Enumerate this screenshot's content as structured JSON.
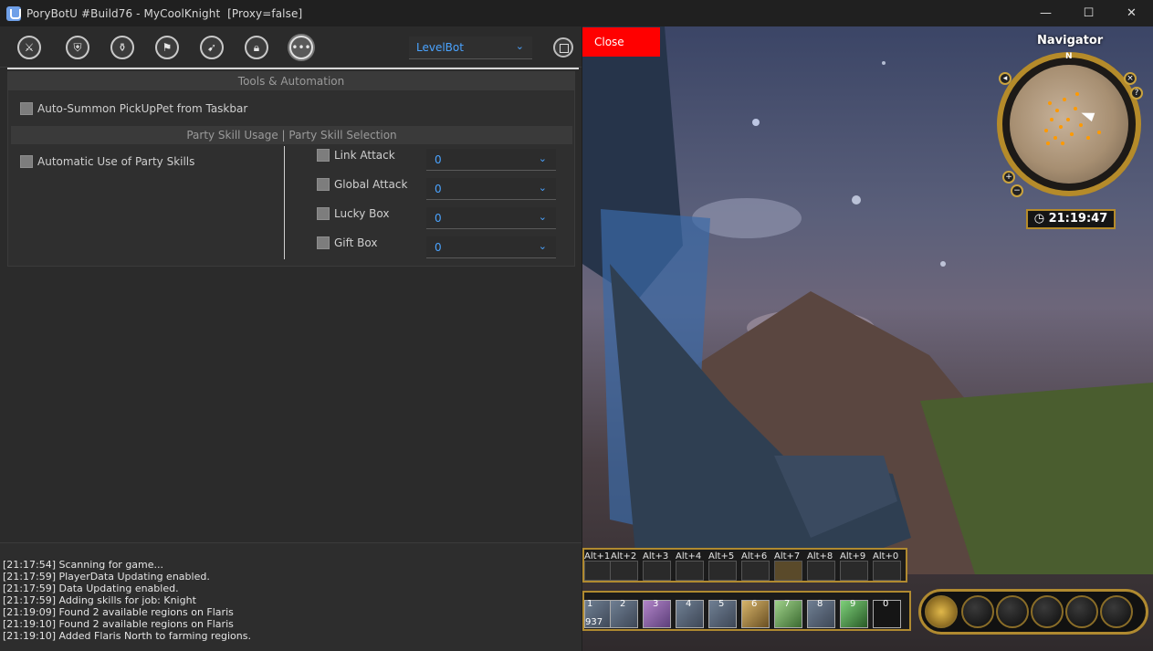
{
  "window": {
    "title": "PoryBotU #Build76 - MyCoolKnight  [Proxy=false]",
    "controls": {
      "minimize": "—",
      "maximize": "☐",
      "close": "✕"
    }
  },
  "toolbar": {
    "icons": [
      "sword-icon",
      "shield-plus-icon",
      "potion-icon",
      "loot-icon",
      "attack-icon",
      "lock-icon",
      "more-icon"
    ],
    "mode_select": "LevelBot",
    "chevron": "⌄"
  },
  "tools": {
    "header": "Tools & Automation",
    "auto_summon_label": "Auto-Summon PickUpPet from Taskbar",
    "party_header": "Party Skill Usage | Party Skill Selection",
    "auto_party_label": "Automatic Use of Party Skills",
    "party_skills": [
      {
        "label": "Link Attack",
        "value": "0"
      },
      {
        "label": "Global Attack",
        "value": "0"
      },
      {
        "label": "Lucky Box",
        "value": "0"
      },
      {
        "label": "Gift Box",
        "value": "0"
      }
    ]
  },
  "log": [
    "[21:17:54] Scanning for game...",
    "[21:17:59] PlayerData Updating enabled.",
    "[21:17:59] Data Updating enabled.",
    "[21:17:59] Adding skills for job: Knight",
    "[21:19:09] Found 2 available regions on Flaris",
    "[21:19:10] Found 2 available regions on Flaris",
    "[21:19:10] Added Flaris North to farming regions."
  ],
  "game": {
    "close_label": "Close",
    "navigator_title": "Navigator",
    "compass_n": "N",
    "clock": "21:19:47",
    "alt_slots": [
      "Alt+1",
      "Alt+2",
      "Alt+3",
      "Alt+4",
      "Alt+5",
      "Alt+6",
      "Alt+7",
      "Alt+8",
      "Alt+9",
      "Alt+0"
    ],
    "main_slots": [
      "1",
      "2",
      "3",
      "4",
      "5",
      "6",
      "7",
      "8",
      "9",
      "0"
    ],
    "slot1_count": "937"
  }
}
